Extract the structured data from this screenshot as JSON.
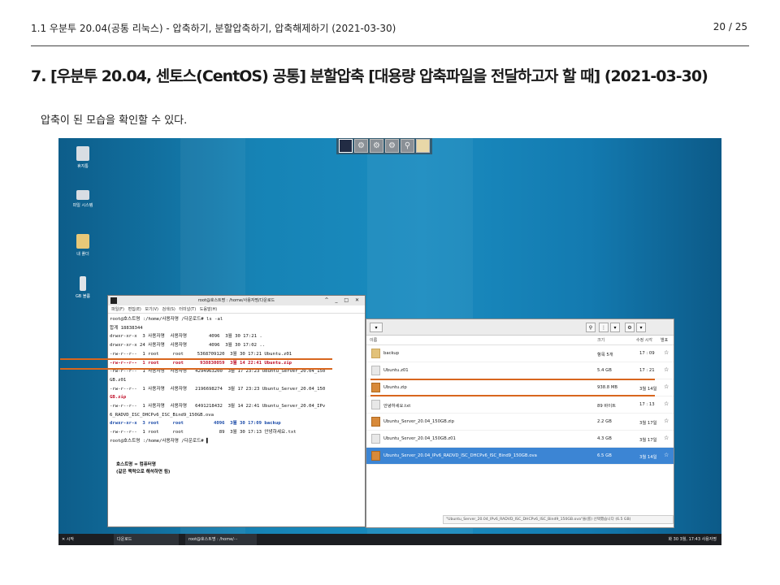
{
  "header": {
    "breadcrumb": "1.1 우분투 20.04(공통 리눅스) - 압축하기, 분할압축하기, 압축해제하기 (2021-03-30)",
    "page_number": "20 / 25"
  },
  "title": "7. [우분투 20.04, 센토스(CentOS) 공통] 분할압축 [대용량 압축파일을 전달하고자 할 때] (2021-03-30)",
  "body_text": "압축이 된 모습을 확인할 수 있다.",
  "desktop_icons": [
    "휴지통",
    "파일 시스템",
    "내 폴더",
    "GB 볼륨"
  ],
  "terminal": {
    "title": "root@호스트명 : /home/사용자명/다운로드",
    "menu": "파일(F)  편집(E)  보기(V)  검색(S)  터미널(T)  도움말(H)",
    "lines": [
      "root@호스트명 :/home/사용자명 /다운로드# ls -al",
      "합계 18838344",
      "drwxr-xr-x  3 사용자명  사용자명        4096  3월 30 17:21 .",
      "drwxr-xr-x 24 사용자명  사용자명        4096  3월 30 17:02 ..",
      "-rw-r--r--  1 root     root     5368709120  3월 30 17:21 Ubuntu.z01",
      "-rw-r--r--  1 root     root      938830059  3월 14 22:41 Ubuntu.zip",
      "-rw-r--r--  1 사용자명  사용자명   4294963200  3월 17 23:23 Ubuntu_Server_20.04_150",
      "GB.z01",
      "-rw-r--r--  1 사용자명  사용자명   2196698274  3월 17 23:23 Ubuntu_Server_20.04_150",
      "GB.zip",
      "-rw-r--r--  1 사용자명  사용자명   6491218432  3월 14 22:41 Ubuntu_Server_20.04_IPv",
      "6_RADVD_ISC_DHCPv6_ISC_Bind9_150GB.ova",
      "drwxr-xr-x  3 root     root           4096  3월 30 17:09 backup",
      "-rw-r--r--  1 root     root             89  3월 30 17:13 안녕하세요.txt",
      "root@호스트명 :/home/사용자명 /다운로드# ▌"
    ],
    "note_line1": "호스트명 = 컴퓨터명",
    "note_line2": "(같은 맥락으로 해석하면 됨)"
  },
  "file_manager": {
    "columns": {
      "name": "이름",
      "size": "크기",
      "date": "수정 시각",
      "star": "별표"
    },
    "rows": [
      {
        "name": "backup",
        "size": "항목 5개",
        "date": "17 : 09",
        "star": "☆"
      },
      {
        "name": "Ubuntu.z01",
        "size": "5.4 GB",
        "date": "17 : 21",
        "star": "☆"
      },
      {
        "name": "Ubuntu.zip",
        "size": "938.8 MB",
        "date": "3월 14일",
        "star": "☆"
      },
      {
        "name": "안녕하세요.txt",
        "size": "89 바이트",
        "date": "17 : 13",
        "star": "☆"
      },
      {
        "name": "Ubuntu_Server_20.04_150GB.zip",
        "size": "2.2 GB",
        "date": "3월 17일",
        "star": "☆"
      },
      {
        "name": "Ubuntu_Server_20.04_150GB.z01",
        "size": "4.3 GB",
        "date": "3월 17일",
        "star": "☆"
      },
      {
        "name": "Ubuntu_Server_20.04_IPv6_RADVD_ISC_DHCPv6_ISC_Bind9_150GB.ova",
        "size": "6.5 GB",
        "date": "3월 14일",
        "star": "☆"
      }
    ],
    "status": "\"Ubuntu_Server_20.04_IPv6_RADVD_ISC_DHCPv6_ISC_Bind9_150GB.ova\"을(를) 선택했습니다 (6.5 GB)"
  },
  "taskbar": {
    "start": "✕ 시작",
    "task1": "다운로드",
    "task2": "root@호스트명 : /home/···",
    "clock": "화 30 3월, 17:43  사용자명"
  },
  "colors": {
    "marker": "#d8661e",
    "selection": "#3c85d4",
    "desktop": "#1683b5"
  }
}
